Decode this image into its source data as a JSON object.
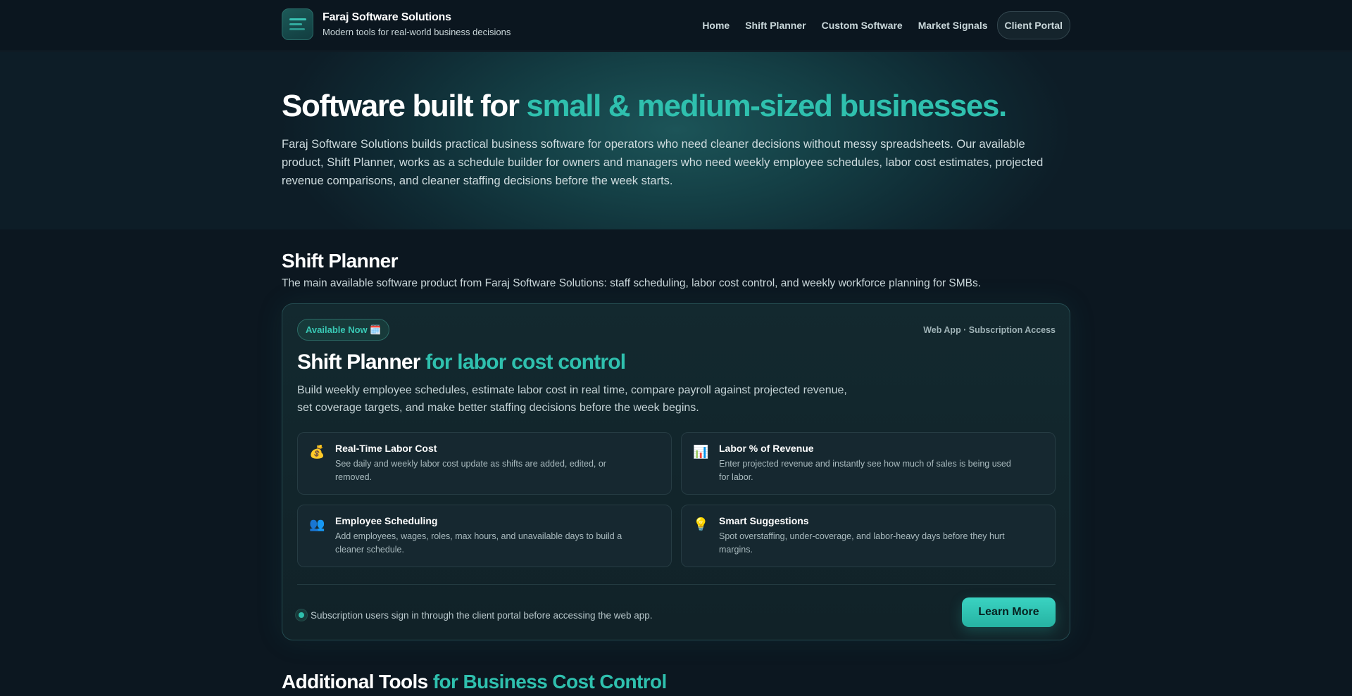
{
  "header": {
    "brand_name": "Faraj Software Solutions",
    "brand_tagline": "Modern tools for real-world business decisions",
    "nav": [
      "Home",
      "Shift Planner",
      "Custom Software",
      "Market Signals",
      "Client Portal"
    ]
  },
  "hero": {
    "title_plain": "Software built for ",
    "title_accent": "small & medium-sized businesses.",
    "description": "Faraj Software Solutions builds practical business software for operators who need cleaner decisions without messy spreadsheets. Our available product, Shift Planner, works as a schedule builder for owners and managers who need weekly employee schedules, labor cost estimates, projected revenue comparisons, and cleaner staffing decisions before the week starts."
  },
  "section": {
    "title": "Shift Planner",
    "subtitle": "The main available software product from Faraj Software Solutions: staff scheduling, labor cost control, and weekly workforce planning for SMBs."
  },
  "product_card": {
    "badge": "Available Now 🗓️",
    "meta": "Web App · Subscription Access",
    "title_plain": "Shift Planner ",
    "title_accent": "for labor cost control",
    "description": "Build weekly employee schedules, estimate labor cost in real time, compare payroll against projected revenue, set coverage targets, and make better staffing decisions before the week begins.",
    "features": [
      {
        "icon": "money-bag-icon",
        "glyph": "💰",
        "title": "Real-Time Labor Cost",
        "desc": "See daily and weekly labor cost update as shifts are added, edited, or removed."
      },
      {
        "icon": "bar-chart-icon",
        "glyph": "📊",
        "title": "Labor % of Revenue",
        "desc": "Enter projected revenue and instantly see how much of sales is being used for labor."
      },
      {
        "icon": "people-icon",
        "glyph": "👥",
        "title": "Employee Scheduling",
        "desc": "Add employees, wages, roles, max hours, and unavailable days to build a cleaner schedule."
      },
      {
        "icon": "lightbulb-icon",
        "glyph": "💡",
        "title": "Smart Suggestions",
        "desc": "Spot overstaffing, under-coverage, and labor-heavy days before they hurt margins."
      }
    ],
    "note": "Subscription users sign in through the client portal before accessing the web app.",
    "cta_label": "Learn More"
  },
  "tools_section": {
    "title_plain": "Additional Tools ",
    "title_accent": "for Business Cost Control"
  },
  "colors": {
    "accent": "#2fc0ae",
    "background": "#0c1720"
  }
}
